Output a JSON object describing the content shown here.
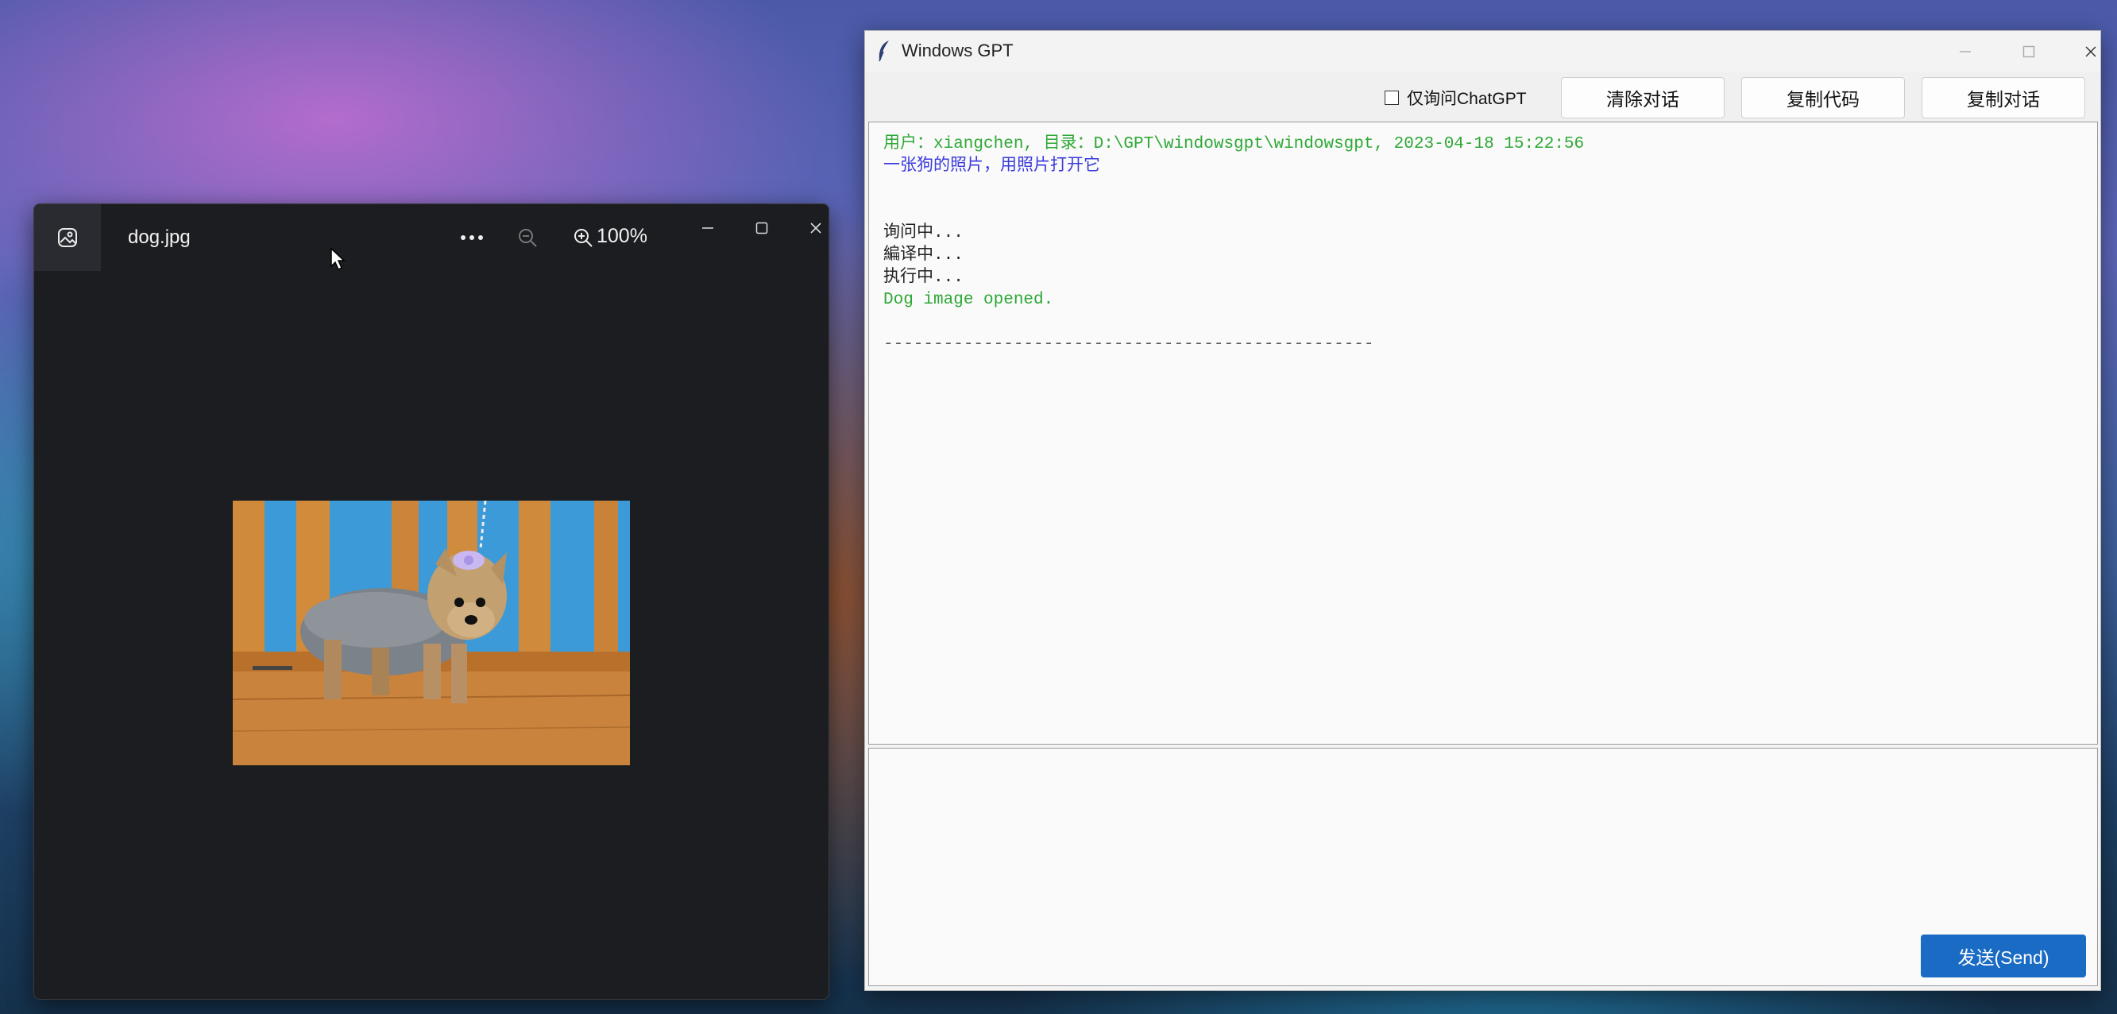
{
  "viewer": {
    "file_name": "dog.jpg",
    "zoom_label": "100%"
  },
  "gpt": {
    "window_title": "Windows GPT",
    "checkbox_label": "仅询问ChatGPT",
    "clear_button": "清除对话",
    "copy_code_button": "复制代码",
    "copy_chat_button": "复制对话",
    "send_button": "发送(Send)",
    "lines": [
      {
        "text": "用户：xiangchen, 目录：D:\\GPT\\windowsgpt\\windowsgpt, 2023-04-18 15:22:56",
        "color": "#2ea836"
      },
      {
        "text": "一张狗的照片，用照片打开它",
        "color": "#3b3bdc"
      },
      {
        "text": "",
        "color": "#000000"
      },
      {
        "text": "",
        "color": "#000000"
      },
      {
        "text": "询问中...",
        "color": "#222222"
      },
      {
        "text": "編译中...",
        "color": "#222222"
      },
      {
        "text": "执行中...",
        "color": "#222222"
      },
      {
        "text": "Dog image opened.",
        "color": "#2ea836"
      },
      {
        "text": "",
        "color": "#000000"
      },
      {
        "text": "-------------------------------------------------",
        "color": "#555555"
      }
    ]
  }
}
